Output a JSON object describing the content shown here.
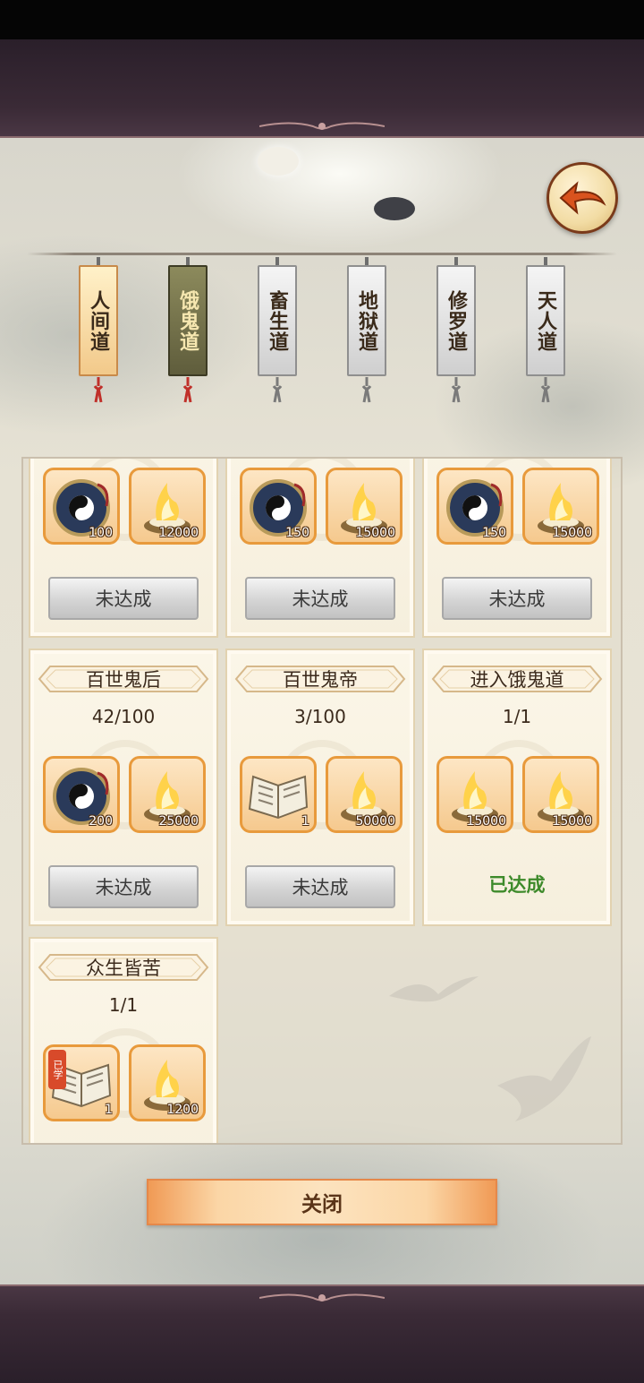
{
  "tabs": [
    {
      "label": "人间道",
      "state": "active"
    },
    {
      "label": "饿鬼道",
      "state": "selected"
    },
    {
      "label": "畜生道",
      "state": "normal"
    },
    {
      "label": "地狱道",
      "state": "normal"
    },
    {
      "label": "修罗道",
      "state": "normal"
    },
    {
      "label": "天人道",
      "state": "normal"
    }
  ],
  "cards": [
    {
      "title": "",
      "progress": "",
      "items": [
        {
          "icon": "taiji-compass-icon",
          "count": "100"
        },
        {
          "icon": "spirit-flame-icon",
          "count": "12000"
        }
      ],
      "status": "未达成"
    },
    {
      "title": "",
      "progress": "",
      "items": [
        {
          "icon": "taiji-compass-icon",
          "count": "150"
        },
        {
          "icon": "spirit-flame-icon",
          "count": "15000"
        }
      ],
      "status": "未达成"
    },
    {
      "title": "",
      "progress": "",
      "items": [
        {
          "icon": "taiji-compass-icon",
          "count": "150"
        },
        {
          "icon": "spirit-flame-icon",
          "count": "15000"
        }
      ],
      "status": "未达成"
    },
    {
      "title": "百世鬼后",
      "progress": "42/100",
      "items": [
        {
          "icon": "taiji-compass-icon",
          "count": "200"
        },
        {
          "icon": "spirit-flame-icon",
          "count": "25000"
        }
      ],
      "status": "未达成"
    },
    {
      "title": "百世鬼帝",
      "progress": "3/100",
      "items": [
        {
          "icon": "skill-book-icon",
          "count": "1"
        },
        {
          "icon": "spirit-flame-icon",
          "count": "50000"
        }
      ],
      "status": "未达成"
    },
    {
      "title": "进入饿鬼道",
      "progress": "1/1",
      "items": [
        {
          "icon": "spirit-flame-icon",
          "count": "15000"
        },
        {
          "icon": "spirit-flame-icon",
          "count": "15000"
        }
      ],
      "status": "已达成"
    },
    {
      "title": "众生皆苦",
      "progress": "1/1",
      "items": [
        {
          "icon": "skill-book-icon",
          "count": "1",
          "badge": "已学"
        },
        {
          "icon": "spirit-flame-icon",
          "count": "1200"
        }
      ],
      "status": ""
    }
  ],
  "close_label": "关闭"
}
